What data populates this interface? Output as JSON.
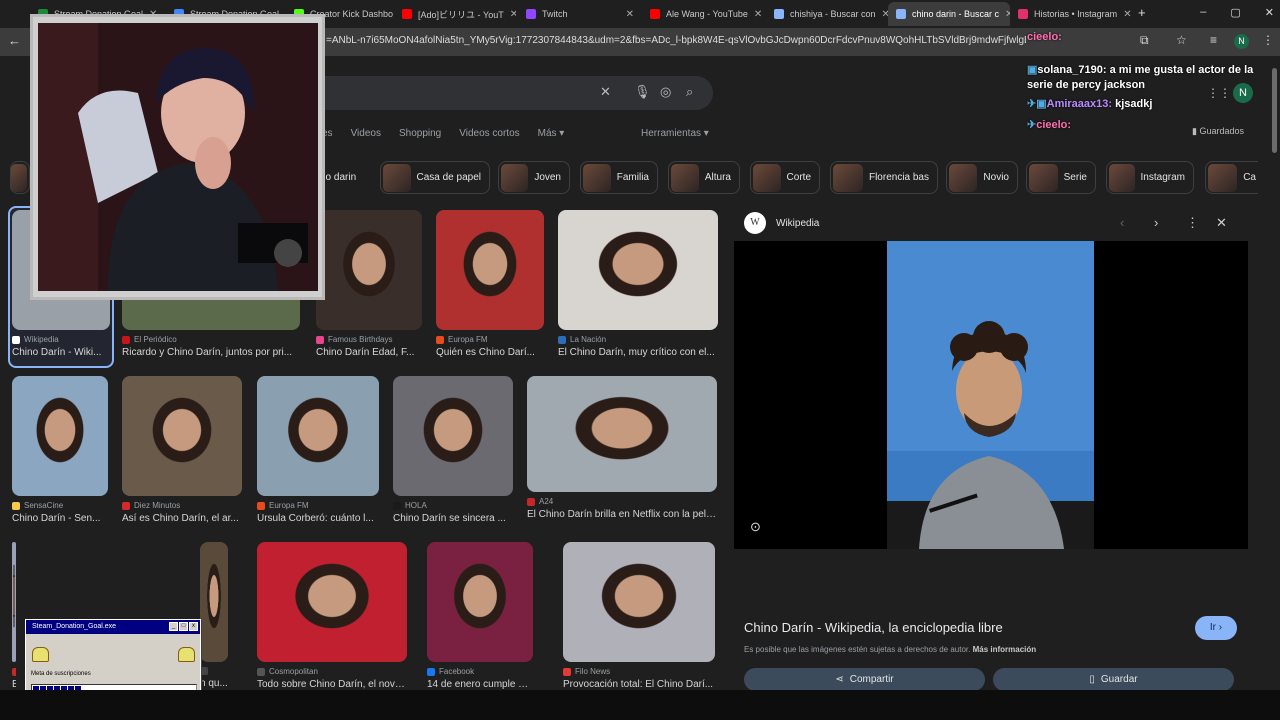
{
  "browser": {
    "tabs": [
      {
        "label": "Stream Donation Goal",
        "color": "#1a8a3a"
      },
      {
        "label": "Stream Donation Goal",
        "color": "#4285f4"
      },
      {
        "label": "Creator Kick Dashbo",
        "color": "#53fc18"
      },
      {
        "label": "[Ado]ビリリユ - YouT",
        "color": "#ff0000"
      },
      {
        "label": "Twitch",
        "color": "#9146ff"
      },
      {
        "label": "Ale Wang - YouTube",
        "color": "#ff0000"
      },
      {
        "label": "chishiya - Buscar con",
        "color": "#8ab4f8"
      },
      {
        "label": "chino darin - Buscar c",
        "color": "#8ab4f8"
      },
      {
        "label": "Historias • Instagram",
        "color": "#e1306c"
      }
    ],
    "url": "=ANbL-n7i65MoON4afolNia5tn_YMy5rVig:1772307844843&udm=2&fbs=ADc_l-bpk8W4E-qsVlOvbGJcDwpn60DcrFdcvPnuv8WQohHLTbSVldBrj9mdwFjfwlgEUgS3rVmfuC",
    "window_controls": [
      "–",
      "▢",
      "✕"
    ],
    "profile_letter": "N"
  },
  "search": {
    "tabs": [
      "es",
      "Videos",
      "Shopping",
      "Videos cortos",
      "Más ▾"
    ],
    "tools": "Herramientas ▾",
    "chips": [
      "do darin",
      "Casa de papel",
      "Joven",
      "Familia",
      "Altura",
      "Corte",
      "Florencia bas",
      "Novio",
      "Serie",
      "Instagram",
      "Ca"
    ]
  },
  "results": [
    {
      "source": "Wikipedia",
      "title": "Chino Darín - Wiki...",
      "src_color": "#ffffff"
    },
    {
      "source": "El Periódico",
      "title": "Ricardo y Chino Darín, juntos por pri...",
      "src_color": "#c4161c"
    },
    {
      "source": "Famous Birthdays",
      "title": "Chino Darín Edad, F...",
      "src_color": "#e8468c"
    },
    {
      "source": "Europa FM",
      "title": "Quién es Chino Darí...",
      "src_color": "#e84b1c"
    },
    {
      "source": "La Nación",
      "title": "El Chino Darín, muy crítico con el...",
      "src_color": "#2a6ebb"
    },
    {
      "source": "SensaCine",
      "title": "Chino Darín - Sen...",
      "src_color": "#f7c948"
    },
    {
      "source": "Diez Minutos",
      "title": "Así es Chino Darín, el ar...",
      "src_color": "#d62828"
    },
    {
      "source": "Europa FM",
      "title": "Úrsula Corberó: cuánto l...",
      "src_color": "#e84b1c"
    },
    {
      "source": "HOLA",
      "title": "Chino Darín se sincera ...",
      "src_color": "#1a1a1a"
    },
    {
      "source": "A24",
      "title": "El Chino Darín brilla en Netflix con la pelí...",
      "src_color": "#c62828"
    },
    {
      "source": "El País",
      "title": "El...",
      "src_color": "#c62828"
    },
    {
      "source": "",
      "title": "n qu...",
      "src_color": "#444444"
    },
    {
      "source": "Cosmopolitan",
      "title": "Todo sobre Chino Darín, el novio...",
      "src_color": "#555555"
    },
    {
      "source": "Facebook",
      "title": "14 de enero cumple 36 ...",
      "src_color": "#1877f2"
    },
    {
      "source": "Filo News",
      "title": "Provocación total: El Chino Darí...",
      "src_color": "#e53935"
    }
  ],
  "panel": {
    "site": "Wikipedia",
    "wiki_logo": "W",
    "title": "Chino Darín - Wikipedia, la enciclopedia libre",
    "open_label": "Ir ›",
    "note": "Es posible que las imágenes estén sujetas a derechos de autor.",
    "note_link": "Más información",
    "share_label": "Compartir",
    "save_label": "Guardar"
  },
  "chat": [
    {
      "user": "cieelo:",
      "msg": "",
      "color": "#ff6fb0"
    },
    {
      "user": "solana_7190:",
      "msg": " a mi me gusta el actor de la serie de percy jackson",
      "color": "#ffffff"
    },
    {
      "user": "Amiraaax13:",
      "msg": " kjsadkj",
      "color": "#b98cff"
    },
    {
      "user": "cieelo:",
      "msg": "",
      "color": "#ff6fb0"
    }
  ],
  "guardados": "Guardados",
  "donation_goal": {
    "window_title": "Steam_Donation_Goal.exe",
    "label": "Meta de suscripciones",
    "progress": 0.3
  }
}
